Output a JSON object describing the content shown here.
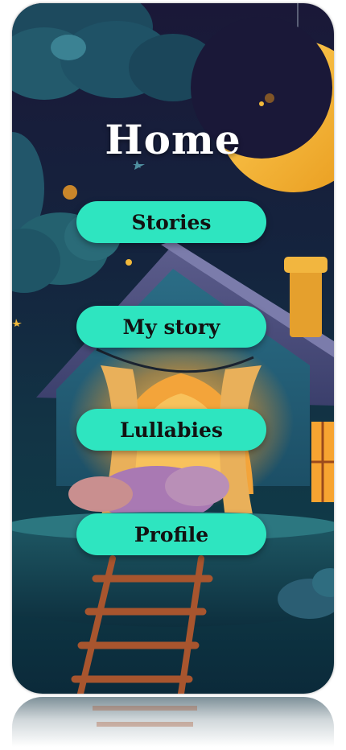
{
  "screen": {
    "title": "Home"
  },
  "menu": {
    "items": [
      {
        "label": "Stories"
      },
      {
        "label": "My story"
      },
      {
        "label": "Lullabies"
      },
      {
        "label": "Profile"
      }
    ]
  },
  "theme": {
    "button_color": "#2ee5c0",
    "button_text_color": "#121212",
    "title_color": "#ffffff",
    "moon_color": "#f5b12c",
    "window_glow_color": "#f7a431"
  },
  "background": {
    "illustration": "night-treehouse-illustration",
    "elements": [
      "clouds",
      "crescent-moon",
      "stars",
      "house",
      "ladder",
      "sleeping-child"
    ]
  }
}
